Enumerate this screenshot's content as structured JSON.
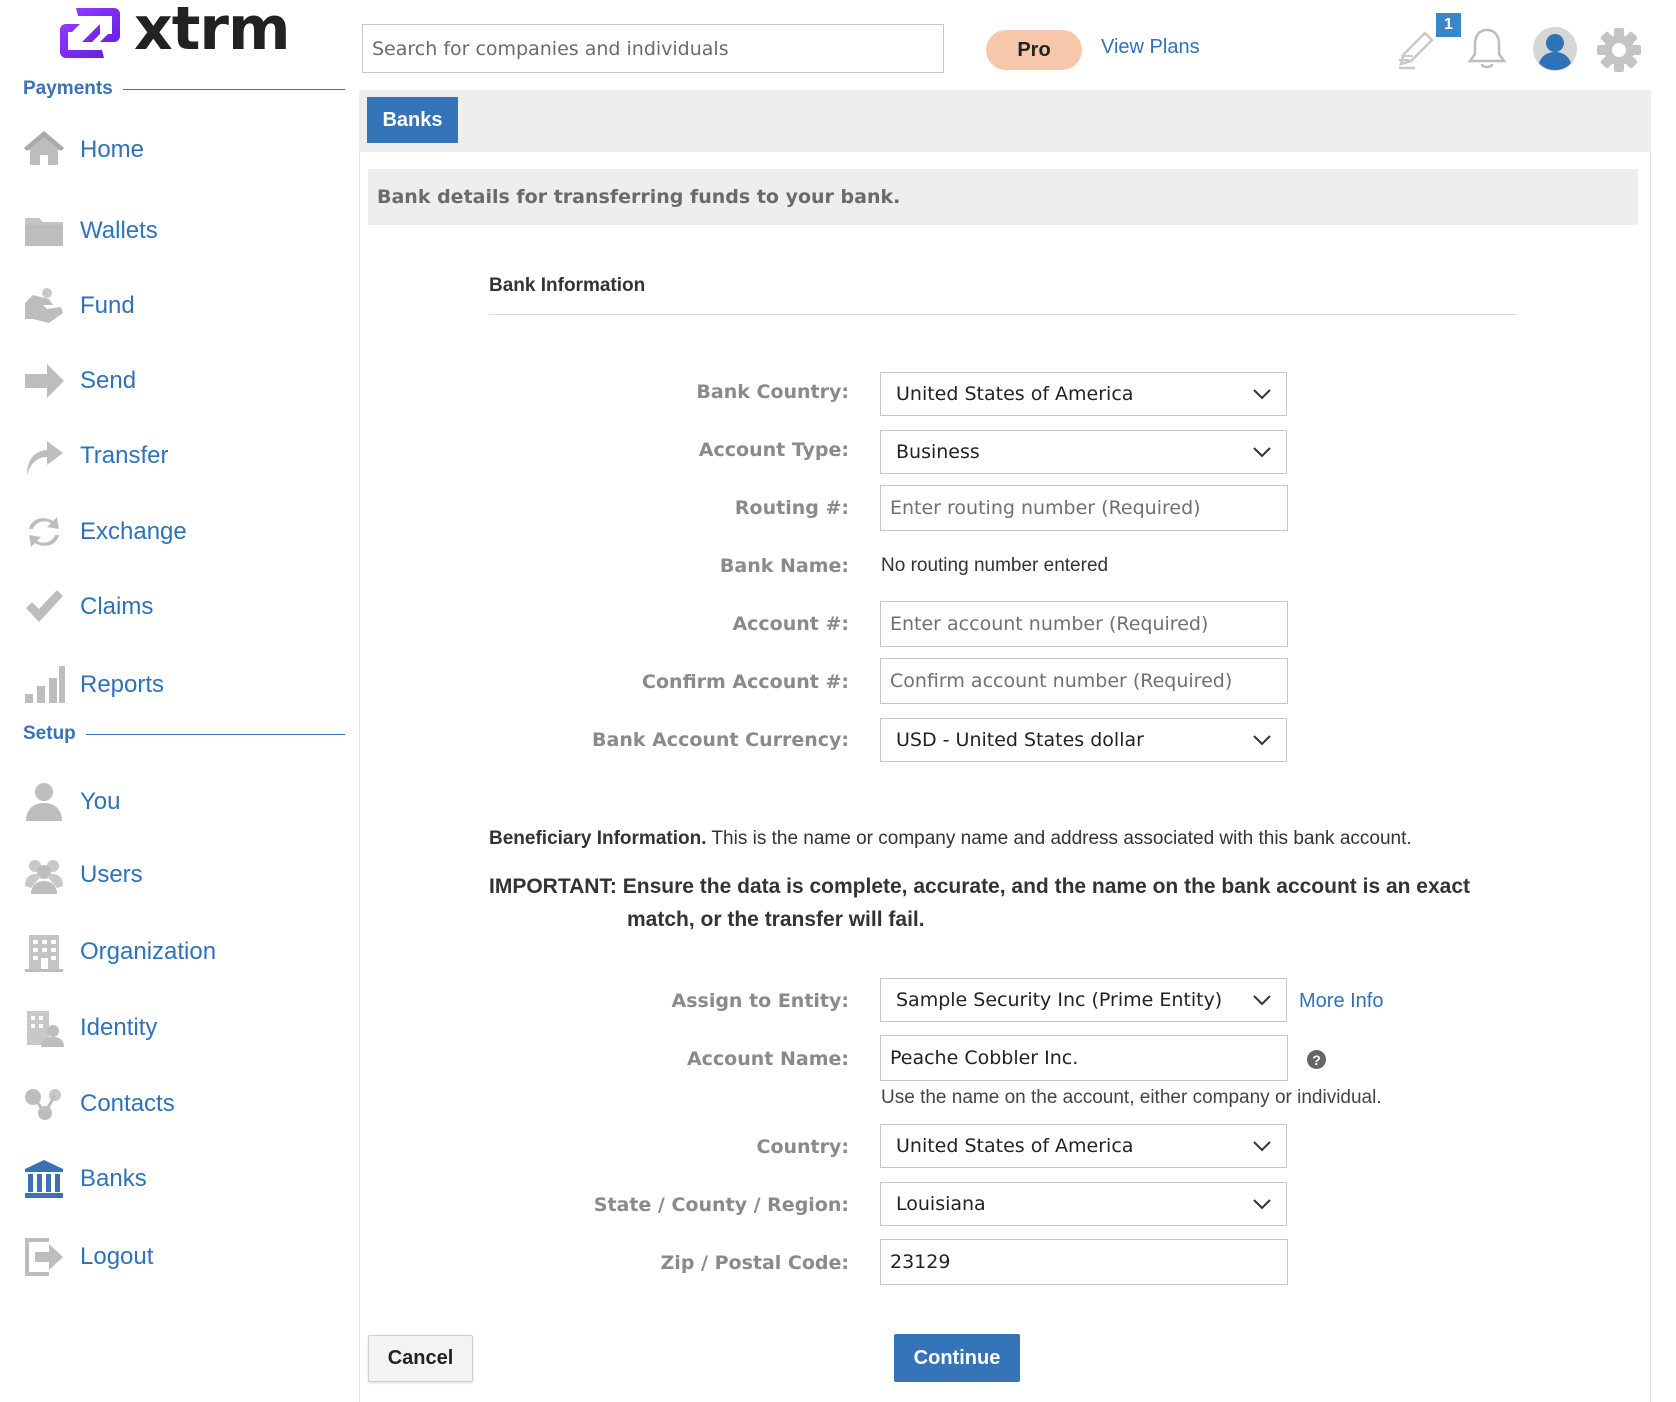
{
  "logo": {
    "word": "xtrm"
  },
  "header": {
    "search_placeholder": "Search for companies and individuals",
    "pro_label": "Pro",
    "view_plans": "View Plans",
    "notification_count": "1"
  },
  "sidebar": {
    "payments_heading": "Payments",
    "setup_heading": "Setup",
    "items": [
      {
        "label": "Home",
        "icon": "home-icon"
      },
      {
        "label": "Wallets",
        "icon": "folder-icon"
      },
      {
        "label": "Fund",
        "icon": "hand-coin-icon"
      },
      {
        "label": "Send",
        "icon": "arrow-right-icon"
      },
      {
        "label": "Transfer",
        "icon": "share-arrow-icon"
      },
      {
        "label": "Exchange",
        "icon": "exchange-icon"
      },
      {
        "label": "Claims",
        "icon": "checkmark-icon"
      },
      {
        "label": "Reports",
        "icon": "bar-chart-icon"
      },
      {
        "label": "You",
        "icon": "person-icon"
      },
      {
        "label": "Users",
        "icon": "users-icon"
      },
      {
        "label": "Organization",
        "icon": "building-icon"
      },
      {
        "label": "Identity",
        "icon": "identity-icon"
      },
      {
        "label": "Contacts",
        "icon": "contacts-icon"
      },
      {
        "label": "Banks",
        "icon": "bank-icon"
      },
      {
        "label": "Logout",
        "icon": "logout-icon"
      }
    ]
  },
  "tabs": {
    "banks": "Banks"
  },
  "notice": "Bank details for transferring funds to your bank.",
  "bank_info": {
    "title": "Bank Information",
    "bank_country_label": "Bank Country:",
    "bank_country_value": "United States of America",
    "account_type_label": "Account Type:",
    "account_type_value": "Business",
    "routing_label": "Routing #:",
    "routing_placeholder": "Enter routing number (Required)",
    "bank_name_label": "Bank Name:",
    "bank_name_value": "No routing number entered",
    "account_label": "Account #:",
    "account_placeholder": "Enter account number (Required)",
    "confirm_label": "Confirm Account #:",
    "confirm_placeholder": "Confirm account number (Required)",
    "currency_label": "Bank Account Currency:",
    "currency_value": "USD - United States dollar"
  },
  "beneficiary": {
    "heading": "Beneficiary Information.",
    "description": " This is the name or company name and address associated with this bank account.",
    "important_line1": "IMPORTANT: Ensure the data is complete, accurate, and the name on the bank account is an exact",
    "important_line2": "match, or the transfer will fail.",
    "entity_label": "Assign to Entity:",
    "entity_value": "Sample Security Inc (Prime Entity)",
    "more_info": "More Info",
    "account_name_label": "Account Name:",
    "account_name_value": "Peache Cobbler Inc.",
    "account_name_hint": "Use the name on the account, either company or individual.",
    "help_glyph": "?",
    "country_label": "Country:",
    "country_value": "United States of America",
    "state_label": "State / County / Region:",
    "state_value": "Louisiana",
    "zip_label": "Zip / Postal Code:",
    "zip_value": "23129"
  },
  "actions": {
    "cancel": "Cancel",
    "continue": "Continue"
  },
  "colors": {
    "accent": "#3574b8",
    "link": "#2f72b8",
    "pro_badge": "#f6c7aa",
    "logo_purple": "#7b2ff7",
    "icon_gray": "#bdbdbd"
  }
}
